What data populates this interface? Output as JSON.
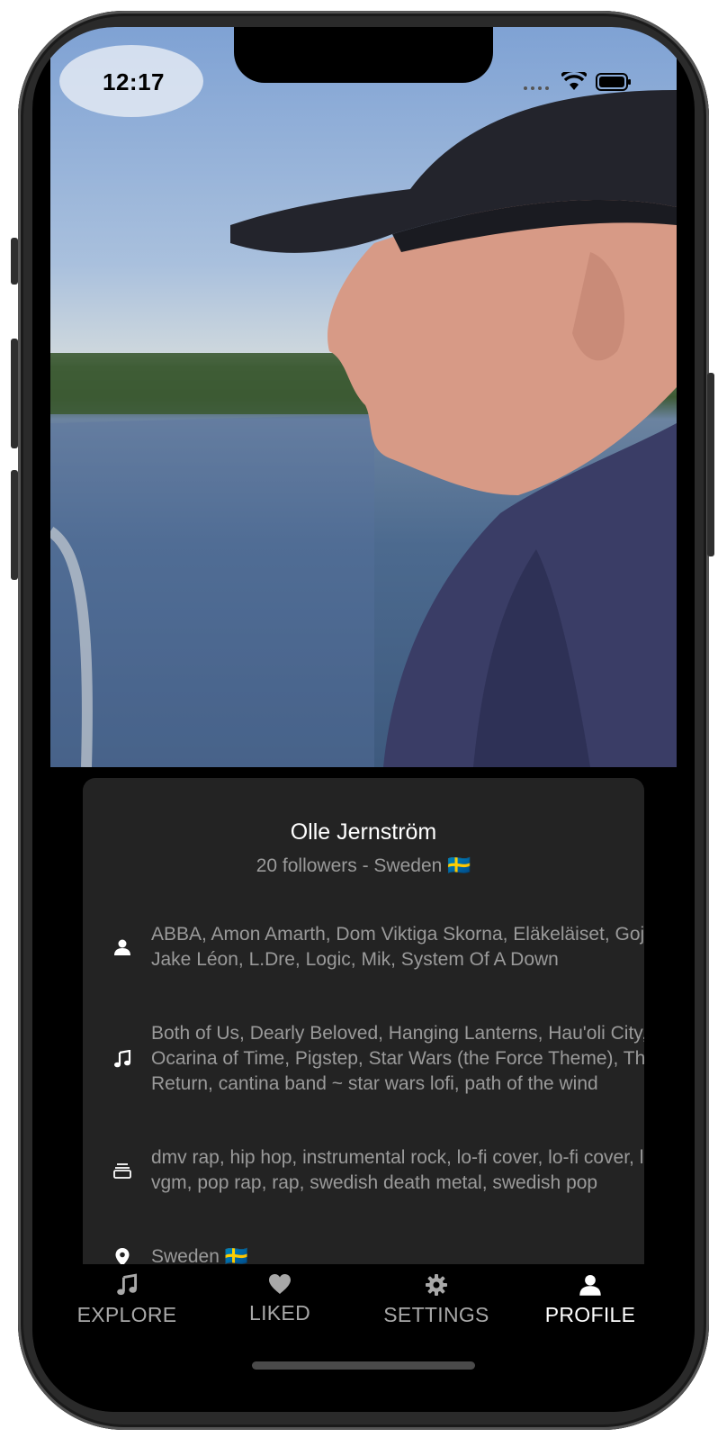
{
  "status_bar": {
    "time": "12:17"
  },
  "profile": {
    "name": "Olle Jernström",
    "subtitle": "20 followers - Sweden 🇸🇪"
  },
  "info_rows": [
    {
      "icon": "person-icon",
      "text": "ABBA, Amon Amarth, Dom Viktiga Skorna, Eläkeläiset, Gojira, Jake Léon, L.Dre, Logic, Mik, System Of A Down"
    },
    {
      "icon": "music-note-icon",
      "text": "Both of Us, Dearly Beloved, Hanging Lanterns, Hau'oli City, Ocarina of Time, Pigstep, Star Wars (the Force Theme), The Return, cantina band ~ star wars lofi, path of the wind"
    },
    {
      "icon": "album-stack-icon",
      "text": "dmv rap, hip hop, instrumental rock, lo-fi cover, lo-fi cover, lo-fi vgm, pop rap, rap, swedish death metal, swedish pop"
    },
    {
      "icon": "location-pin-icon",
      "text": "Sweden 🇸🇪"
    }
  ],
  "tabs": [
    {
      "label": "EXPLORE",
      "icon": "music-note-icon",
      "active": false
    },
    {
      "label": "LIKED",
      "icon": "heart-icon",
      "active": false
    },
    {
      "label": "SETTINGS",
      "icon": "gear-icon",
      "active": false
    },
    {
      "label": "PROFILE",
      "icon": "person-icon",
      "active": true
    }
  ],
  "colors": {
    "card": "#232323",
    "secondary_text": "#9a9a9a",
    "active_tab": "#ffffff",
    "inactive_tab": "#a8a8a8"
  }
}
